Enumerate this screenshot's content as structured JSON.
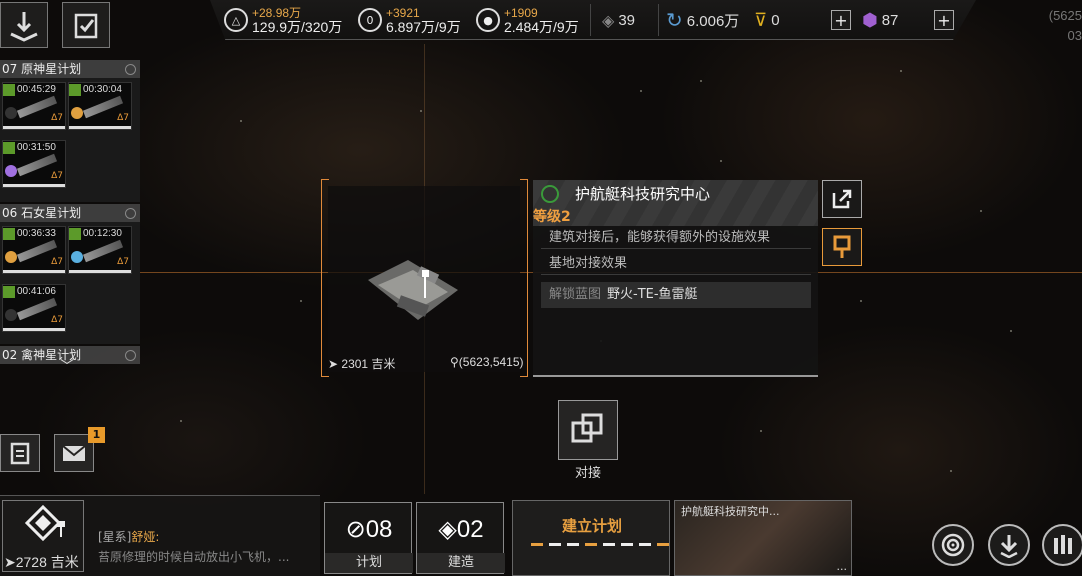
{
  "topbar": {
    "resources": [
      {
        "icon": "triangle-resource-icon",
        "delta": "+28.98万",
        "value": "129.9万/320万"
      },
      {
        "icon": "zero-resource-icon",
        "delta": "+3921",
        "value": "6.897万/9万"
      },
      {
        "icon": "orb-resource-icon",
        "delta": "+1909",
        "value": "2.484万/9万"
      }
    ],
    "diamond_count": "39",
    "credits": "6.006万",
    "gold": "0",
    "premium": "87",
    "coord_partial": "(5625 03"
  },
  "plans": [
    {
      "name": "07 原神星计划",
      "ships": [
        {
          "timer": "00:45:29",
          "dot": "#333"
        },
        {
          "timer": "00:30:04",
          "dot": "#e0a040"
        },
        {
          "timer": "00:31:50",
          "dot": "#a070e0"
        }
      ]
    },
    {
      "name": "06 石女星计划",
      "ships": [
        {
          "timer": "00:36:33",
          "dot": "#e0a040"
        },
        {
          "timer": "00:12:30",
          "dot": "#5ab0e0"
        },
        {
          "timer": "00:41:06",
          "dot": "#333"
        }
      ]
    },
    {
      "name": "02 禽神星计划",
      "ships": []
    }
  ],
  "ship_tier": "Δ7",
  "target": {
    "distance": "2301 吉米",
    "position": "(5623,5415)"
  },
  "info": {
    "title": "护航艇科技研究中心",
    "level": "等级2",
    "desc": "建筑对接后，能够获得额外的设施效果",
    "base_effect": "基地对接效果",
    "unlock_label": "解锁蓝图",
    "unlock_value": "野火-TE-鱼雷艇"
  },
  "dock_label": "对接",
  "mail_badge": "1",
  "home_distance": "➤2728 吉米",
  "chat": {
    "channel": "[星系]",
    "name": "舒娅:",
    "message": "苔原修理的时候自动放出小飞机，..."
  },
  "plan_count": "08",
  "plan_label": "计划",
  "build_count": "02",
  "build_label": "建造",
  "build_plan_title": "建立计划",
  "preview_title": "护航艇科技研究中...",
  "preview_more": "..."
}
